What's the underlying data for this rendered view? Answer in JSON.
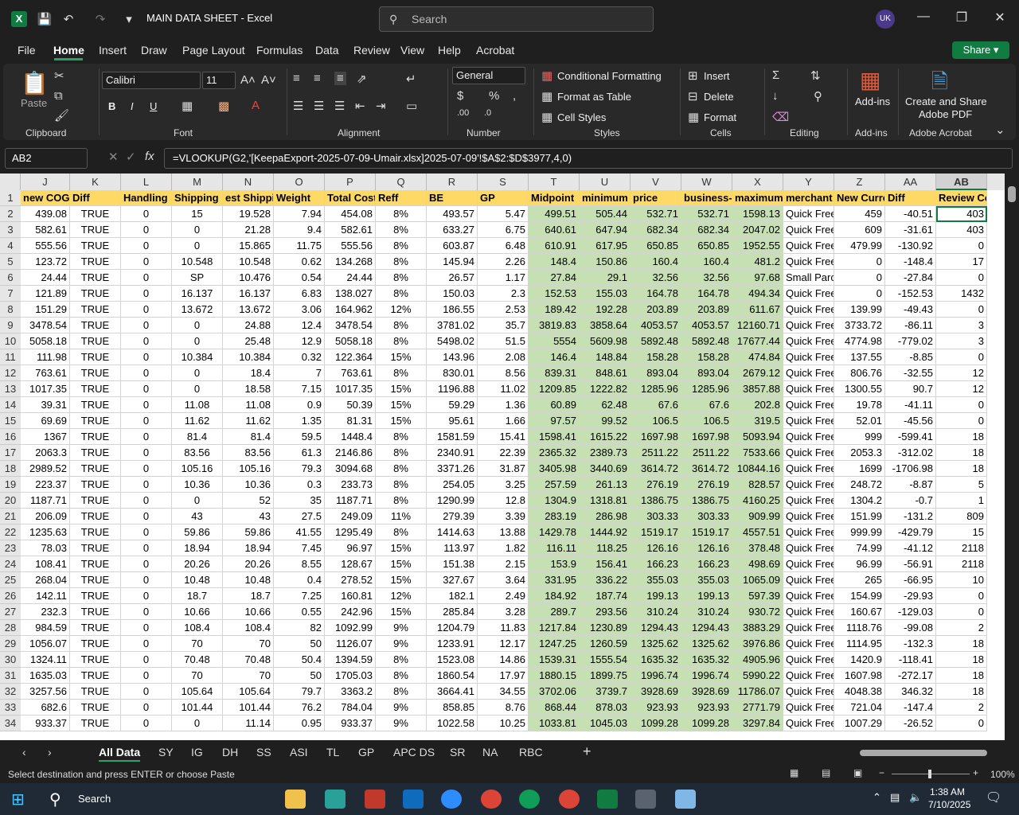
{
  "window": {
    "title": "MAIN DATA SHEET  -  Excel",
    "search_placeholder": "Search",
    "user_initials": "UK"
  },
  "menu": [
    "File",
    "Home",
    "Insert",
    "Draw",
    "Page Layout",
    "Formulas",
    "Data",
    "Review",
    "View",
    "Help",
    "Acrobat"
  ],
  "share_label": "Share",
  "ribbon": {
    "clipboard": {
      "paste": "Paste",
      "label": "Clipboard"
    },
    "font": {
      "name": "Calibri",
      "size": "11",
      "label": "Font",
      "bold": "B",
      "italic": "I",
      "underline": "U"
    },
    "alignment": {
      "label": "Alignment"
    },
    "number": {
      "format": "General",
      "label": "Number"
    },
    "styles": {
      "conditional": "Conditional Formatting",
      "format_table": "Format as Table",
      "cell_styles": "Cell Styles",
      "label": "Styles"
    },
    "cells": {
      "insert": "Insert",
      "delete": "Delete",
      "format": "Format",
      "label": "Cells"
    },
    "editing": {
      "label": "Editing"
    },
    "addins": {
      "button": "Add-ins",
      "label": "Add-ins"
    },
    "acrobat": {
      "button_line1": "Create and Share",
      "button_line2": "Adobe PDF",
      "label": "Adobe Acrobat"
    }
  },
  "formula_bar": {
    "name_box": "AB2",
    "formula": "=VLOOKUP(G2,'[KeepaExport-2025-07-09-Umair.xlsx]2025-07-09'!$A$2:$D$3977,4,0)"
  },
  "columns": [
    "J",
    "K",
    "L",
    "M",
    "N",
    "O",
    "P",
    "Q",
    "R",
    "S",
    "T",
    "U",
    "V",
    "W",
    "X",
    "Y",
    "Z",
    "AA",
    "AB"
  ],
  "headers": [
    "new COG",
    "Diff",
    "Handling",
    "Shipping",
    "est Shippi",
    "Weight",
    "Total Cost",
    "Reff",
    "BE",
    "GP",
    "Midpoint",
    "minimum",
    "price",
    "business-",
    "maximum",
    "merchant",
    "New Curre",
    "Diff",
    "Review Cour"
  ],
  "rows": [
    [
      "439.08",
      "TRUE",
      "0",
      "15",
      "19.528",
      "7.94",
      "454.08",
      "8%",
      "493.57",
      "5.47",
      "499.51",
      "505.44",
      "532.71",
      "532.71",
      "1598.13",
      "Quick Free",
      "459",
      "-40.51",
      "403"
    ],
    [
      "582.61",
      "TRUE",
      "0",
      "0",
      "21.28",
      "9.4",
      "582.61",
      "8%",
      "633.27",
      "6.75",
      "640.61",
      "647.94",
      "682.34",
      "682.34",
      "2047.02",
      "Quick Free",
      "609",
      "-31.61",
      "403"
    ],
    [
      "555.56",
      "TRUE",
      "0",
      "0",
      "15.865",
      "11.75",
      "555.56",
      "8%",
      "603.87",
      "6.48",
      "610.91",
      "617.95",
      "650.85",
      "650.85",
      "1952.55",
      "Quick Free",
      "479.99",
      "-130.92",
      "0"
    ],
    [
      "123.72",
      "TRUE",
      "0",
      "10.548",
      "10.548",
      "0.62",
      "134.268",
      "8%",
      "145.94",
      "2.26",
      "148.4",
      "150.86",
      "160.4",
      "160.4",
      "481.2",
      "Quick Free",
      "0",
      "-148.4",
      "17"
    ],
    [
      "24.44",
      "TRUE",
      "0",
      "SP",
      "10.476",
      "0.54",
      "24.44",
      "8%",
      "26.57",
      "1.17",
      "27.84",
      "29.1",
      "32.56",
      "32.56",
      "97.68",
      "Small Parc",
      "0",
      "-27.84",
      "0"
    ],
    [
      "121.89",
      "TRUE",
      "0",
      "16.137",
      "16.137",
      "6.83",
      "138.027",
      "8%",
      "150.03",
      "2.3",
      "152.53",
      "155.03",
      "164.78",
      "164.78",
      "494.34",
      "Quick Free",
      "0",
      "-152.53",
      "1432"
    ],
    [
      "151.29",
      "TRUE",
      "0",
      "13.672",
      "13.672",
      "3.06",
      "164.962",
      "12%",
      "186.55",
      "2.53",
      "189.42",
      "192.28",
      "203.89",
      "203.89",
      "611.67",
      "Quick Free",
      "139.99",
      "-49.43",
      "0"
    ],
    [
      "3478.54",
      "TRUE",
      "0",
      "0",
      "24.88",
      "12.4",
      "3478.54",
      "8%",
      "3781.02",
      "35.7",
      "3819.83",
      "3858.64",
      "4053.57",
      "4053.57",
      "12160.71",
      "Quick Free",
      "3733.72",
      "-86.11",
      "3"
    ],
    [
      "5058.18",
      "TRUE",
      "0",
      "0",
      "25.48",
      "12.9",
      "5058.18",
      "8%",
      "5498.02",
      "51.5",
      "5554",
      "5609.98",
      "5892.48",
      "5892.48",
      "17677.44",
      "Quick Free",
      "4774.98",
      "-779.02",
      "3"
    ],
    [
      "111.98",
      "TRUE",
      "0",
      "10.384",
      "10.384",
      "0.32",
      "122.364",
      "15%",
      "143.96",
      "2.08",
      "146.4",
      "148.84",
      "158.28",
      "158.28",
      "474.84",
      "Quick Free",
      "137.55",
      "-8.85",
      "0"
    ],
    [
      "763.61",
      "TRUE",
      "0",
      "0",
      "18.4",
      "7",
      "763.61",
      "8%",
      "830.01",
      "8.56",
      "839.31",
      "848.61",
      "893.04",
      "893.04",
      "2679.12",
      "Quick Free",
      "806.76",
      "-32.55",
      "12"
    ],
    [
      "1017.35",
      "TRUE",
      "0",
      "0",
      "18.58",
      "7.15",
      "1017.35",
      "15%",
      "1196.88",
      "11.02",
      "1209.85",
      "1222.82",
      "1285.96",
      "1285.96",
      "3857.88",
      "Quick Free",
      "1300.55",
      "90.7",
      "12"
    ],
    [
      "39.31",
      "TRUE",
      "0",
      "11.08",
      "11.08",
      "0.9",
      "50.39",
      "15%",
      "59.29",
      "1.36",
      "60.89",
      "62.48",
      "67.6",
      "67.6",
      "202.8",
      "Quick Free",
      "19.78",
      "-41.11",
      "0"
    ],
    [
      "69.69",
      "TRUE",
      "0",
      "11.62",
      "11.62",
      "1.35",
      "81.31",
      "15%",
      "95.61",
      "1.66",
      "97.57",
      "99.52",
      "106.5",
      "106.5",
      "319.5",
      "Quick Free",
      "52.01",
      "-45.56",
      "0"
    ],
    [
      "1367",
      "TRUE",
      "0",
      "81.4",
      "81.4",
      "59.5",
      "1448.4",
      "8%",
      "1581.59",
      "15.41",
      "1598.41",
      "1615.22",
      "1697.98",
      "1697.98",
      "5093.94",
      "Quick Free",
      "999",
      "-599.41",
      "18"
    ],
    [
      "2063.3",
      "TRUE",
      "0",
      "83.56",
      "83.56",
      "61.3",
      "2146.86",
      "8%",
      "2340.91",
      "22.39",
      "2365.32",
      "2389.73",
      "2511.22",
      "2511.22",
      "7533.66",
      "Quick Free",
      "2053.3",
      "-312.02",
      "18"
    ],
    [
      "2989.52",
      "TRUE",
      "0",
      "105.16",
      "105.16",
      "79.3",
      "3094.68",
      "8%",
      "3371.26",
      "31.87",
      "3405.98",
      "3440.69",
      "3614.72",
      "3614.72",
      "10844.16",
      "Quick Free",
      "1699",
      "-1706.98",
      "18"
    ],
    [
      "223.37",
      "TRUE",
      "0",
      "10.36",
      "10.36",
      "0.3",
      "233.73",
      "8%",
      "254.05",
      "3.25",
      "257.59",
      "261.13",
      "276.19",
      "276.19",
      "828.57",
      "Quick Free",
      "248.72",
      "-8.87",
      "5"
    ],
    [
      "1187.71",
      "TRUE",
      "0",
      "0",
      "52",
      "35",
      "1187.71",
      "8%",
      "1290.99",
      "12.8",
      "1304.9",
      "1318.81",
      "1386.75",
      "1386.75",
      "4160.25",
      "Quick Free",
      "1304.2",
      "-0.7",
      "1"
    ],
    [
      "206.09",
      "TRUE",
      "0",
      "43",
      "43",
      "27.5",
      "249.09",
      "11%",
      "279.39",
      "3.39",
      "283.19",
      "286.98",
      "303.33",
      "303.33",
      "909.99",
      "Quick Free",
      "151.99",
      "-131.2",
      "809"
    ],
    [
      "1235.63",
      "TRUE",
      "0",
      "59.86",
      "59.86",
      "41.55",
      "1295.49",
      "8%",
      "1414.63",
      "13.88",
      "1429.78",
      "1444.92",
      "1519.17",
      "1519.17",
      "4557.51",
      "Quick Free",
      "999.99",
      "-429.79",
      "15"
    ],
    [
      "78.03",
      "TRUE",
      "0",
      "18.94",
      "18.94",
      "7.45",
      "96.97",
      "15%",
      "113.97",
      "1.82",
      "116.11",
      "118.25",
      "126.16",
      "126.16",
      "378.48",
      "Quick Free",
      "74.99",
      "-41.12",
      "2118"
    ],
    [
      "108.41",
      "TRUE",
      "0",
      "20.26",
      "20.26",
      "8.55",
      "128.67",
      "15%",
      "151.38",
      "2.15",
      "153.9",
      "156.41",
      "166.23",
      "166.23",
      "498.69",
      "Quick Free",
      "96.99",
      "-56.91",
      "2118"
    ],
    [
      "268.04",
      "TRUE",
      "0",
      "10.48",
      "10.48",
      "0.4",
      "278.52",
      "15%",
      "327.67",
      "3.64",
      "331.95",
      "336.22",
      "355.03",
      "355.03",
      "1065.09",
      "Quick Free",
      "265",
      "-66.95",
      "10"
    ],
    [
      "142.11",
      "TRUE",
      "0",
      "18.7",
      "18.7",
      "7.25",
      "160.81",
      "12%",
      "182.1",
      "2.49",
      "184.92",
      "187.74",
      "199.13",
      "199.13",
      "597.39",
      "Quick Free",
      "154.99",
      "-29.93",
      "0"
    ],
    [
      "232.3",
      "TRUE",
      "0",
      "10.66",
      "10.66",
      "0.55",
      "242.96",
      "15%",
      "285.84",
      "3.28",
      "289.7",
      "293.56",
      "310.24",
      "310.24",
      "930.72",
      "Quick Free",
      "160.67",
      "-129.03",
      "0"
    ],
    [
      "984.59",
      "TRUE",
      "0",
      "108.4",
      "108.4",
      "82",
      "1092.99",
      "9%",
      "1204.79",
      "11.83",
      "1217.84",
      "1230.89",
      "1294.43",
      "1294.43",
      "3883.29",
      "Quick Free",
      "1118.76",
      "-99.08",
      "2"
    ],
    [
      "1056.07",
      "TRUE",
      "0",
      "70",
      "70",
      "50",
      "1126.07",
      "9%",
      "1233.91",
      "12.17",
      "1247.25",
      "1260.59",
      "1325.62",
      "1325.62",
      "3976.86",
      "Quick Free",
      "1114.95",
      "-132.3",
      "18"
    ],
    [
      "1324.11",
      "TRUE",
      "0",
      "70.48",
      "70.48",
      "50.4",
      "1394.59",
      "8%",
      "1523.08",
      "14.86",
      "1539.31",
      "1555.54",
      "1635.32",
      "1635.32",
      "4905.96",
      "Quick Free",
      "1420.9",
      "-118.41",
      "18"
    ],
    [
      "1635.03",
      "TRUE",
      "0",
      "70",
      "70",
      "50",
      "1705.03",
      "8%",
      "1860.54",
      "17.97",
      "1880.15",
      "1899.75",
      "1996.74",
      "1996.74",
      "5990.22",
      "Quick Free",
      "1607.98",
      "-272.17",
      "18"
    ],
    [
      "3257.56",
      "TRUE",
      "0",
      "105.64",
      "105.64",
      "79.7",
      "3363.2",
      "8%",
      "3664.41",
      "34.55",
      "3702.06",
      "3739.7",
      "3928.69",
      "3928.69",
      "11786.07",
      "Quick Free",
      "4048.38",
      "346.32",
      "18"
    ],
    [
      "682.6",
      "TRUE",
      "0",
      "101.44",
      "101.44",
      "76.2",
      "784.04",
      "9%",
      "858.85",
      "8.76",
      "868.44",
      "878.03",
      "923.93",
      "923.93",
      "2771.79",
      "Quick Free",
      "721.04",
      "-147.4",
      "2"
    ],
    [
      "933.37",
      "TRUE",
      "0",
      "0",
      "11.14",
      "0.95",
      "933.37",
      "9%",
      "1022.58",
      "10.25",
      "1033.81",
      "1045.03",
      "1099.28",
      "1099.28",
      "3297.84",
      "Quick Free",
      "1007.29",
      "-26.52",
      "0"
    ]
  ],
  "sheet_tabs": [
    "All Data",
    "SY",
    "IG",
    "DH",
    "SS",
    "ASI",
    "TL",
    "GP",
    "APC DS",
    "SR",
    "NA",
    "RBC"
  ],
  "status": {
    "message": "Select destination and press ENTER or choose Paste",
    "zoom": "100%"
  },
  "taskbar": {
    "search": "Search",
    "time": "1:38 AM",
    "date": "7/10/2025"
  }
}
